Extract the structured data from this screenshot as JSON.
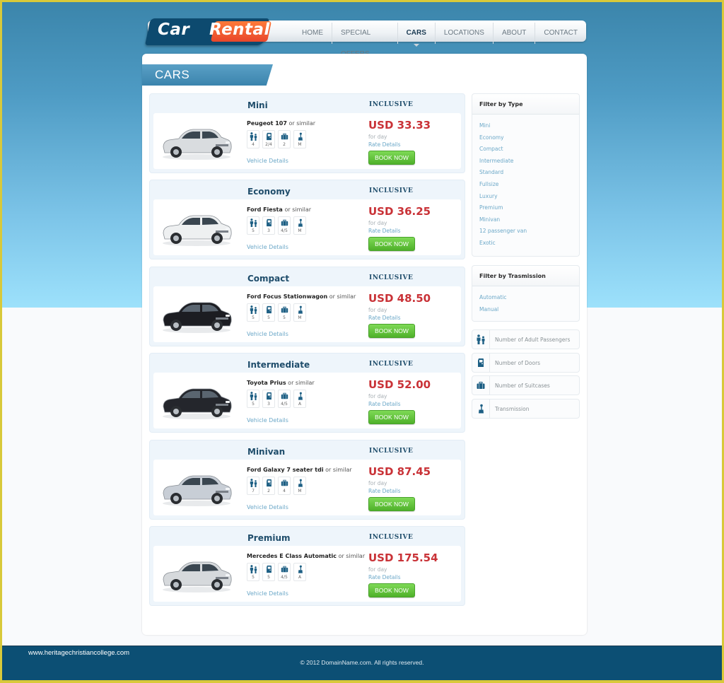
{
  "brand": {
    "part1": "Car",
    "part2": "Rental"
  },
  "nav": {
    "items": [
      {
        "label": "HOME",
        "active": false
      },
      {
        "label": "SPECIAL OFFERS",
        "active": false
      },
      {
        "label": "CARS",
        "active": true
      },
      {
        "label": "LOCATIONS",
        "active": false
      },
      {
        "label": "ABOUT",
        "active": false
      },
      {
        "label": "CONTACT",
        "active": false
      }
    ]
  },
  "page": {
    "title": "CARS"
  },
  "labels": {
    "inclusive": "INCLUSIVE",
    "or_similar": "or similar",
    "per_day": "for day",
    "rate_details": "Rate Details",
    "vehicle_details": "Vehicle Details",
    "book_now": "BOOK NOW"
  },
  "cars": [
    {
      "type": "Mini",
      "model": "Peugeot 107",
      "price": "USD 33.33",
      "passengers": "4",
      "doors": "2/4",
      "suitcases": "2",
      "transmission": "M",
      "color": "#d9dcdf"
    },
    {
      "type": "Economy",
      "model": "Ford Fiesta ",
      "price": "USD 36.25",
      "passengers": "5",
      "doors": "3",
      "suitcases": "4/5",
      "transmission": "M",
      "color": "#eef0f1"
    },
    {
      "type": "Compact",
      "model": "Ford Focus Stationwagon",
      "price": "USD 48.50",
      "passengers": "5",
      "doors": "5",
      "suitcases": "5",
      "transmission": "M",
      "color": "#1c1d22"
    },
    {
      "type": "Intermediate",
      "model": "Toyota Prius",
      "price": "USD 52.00",
      "passengers": "5",
      "doors": "3",
      "suitcases": "4/5",
      "transmission": "A",
      "color": "#24262c"
    },
    {
      "type": "Minivan",
      "model": "Ford Galaxy 7 seater tdi",
      "price": "USD 87.45",
      "passengers": "7",
      "doors": "2",
      "suitcases": "4",
      "transmission": "M",
      "color": "#c8ced6"
    },
    {
      "type": "Premium",
      "model": "Mercedes E Class Automatic",
      "price": "USD 175.54",
      "passengers": "5",
      "doors": "5",
      "suitcases": "4/5",
      "transmission": "A",
      "color": "#d6d9dc"
    }
  ],
  "sidebar": {
    "filter_type": {
      "title": "Filter by Type",
      "items": [
        "Mini",
        "Economy",
        "Compact",
        "Intermediate",
        "Standard",
        "Fullsize",
        "Luxury",
        "Premium",
        "Minivan",
        "12 passenger van",
        "Exotic"
      ]
    },
    "filter_transmission": {
      "title": "Filter by Trasmission",
      "items": [
        "Automatic",
        "Manual"
      ]
    },
    "legend": [
      {
        "icon": "passengers-icon",
        "label": "Number of Adult Passengers"
      },
      {
        "icon": "door-icon",
        "label": "Number of Doors"
      },
      {
        "icon": "suitcase-icon",
        "label": "Number of Suitcases"
      },
      {
        "icon": "gearshift-icon",
        "label": "Transmission"
      }
    ]
  },
  "footer": {
    "site": "www.heritagechristiancollege.com",
    "copyright": "© 2012 DomainName.com. All rights reserved."
  },
  "colors": {
    "accent": "#1f4d6b",
    "price": "#c93237",
    "link": "#6ca8c8",
    "button": "#5cbf33",
    "footer": "#0c4f74"
  }
}
